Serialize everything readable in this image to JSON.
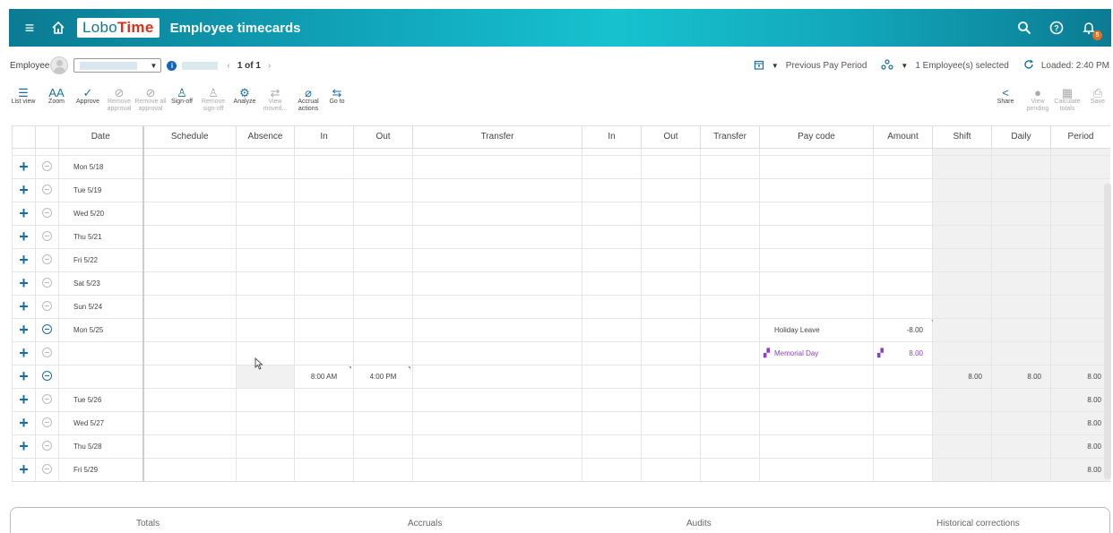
{
  "header": {
    "logo_lobo": "Lobo",
    "logo_time": "Time",
    "title": "Employee timecards",
    "notification_count": "5",
    "icons": [
      "menu-icon",
      "home-icon",
      "search-icon",
      "help-icon",
      "bell-icon"
    ]
  },
  "employee_bar": {
    "label": "Employee",
    "pager": "1 of 1",
    "period": "Previous Pay Period",
    "selected": "1 Employee(s) selected",
    "loaded": "Loaded: 2:40 PM"
  },
  "toolbar": {
    "left": [
      {
        "label": "List view",
        "icon": "list-icon",
        "glyph": "☰",
        "enabled": true
      },
      {
        "label": "Zoom",
        "icon": "zoom-icon",
        "glyph": "AA",
        "enabled": true
      },
      {
        "label": "Approve",
        "icon": "check-icon",
        "glyph": "✓",
        "enabled": true
      },
      {
        "label": "Remove approval",
        "icon": "remove-approval-icon",
        "glyph": "⊘",
        "enabled": false
      },
      {
        "label": "Remove all approval",
        "icon": "remove-all-approval-icon",
        "glyph": "⊘",
        "enabled": false
      },
      {
        "label": "Sign-off",
        "icon": "sign-off-icon",
        "glyph": "♙",
        "enabled": true
      },
      {
        "label": "Remove sign-off",
        "icon": "remove-sign-off-icon",
        "glyph": "♙",
        "enabled": false
      },
      {
        "label": "Analyze",
        "icon": "analyze-icon",
        "glyph": "⚙",
        "enabled": true
      },
      {
        "label": "View moved...",
        "icon": "view-moved-icon",
        "glyph": "⇄",
        "enabled": false
      },
      {
        "label": "Accrual actions",
        "icon": "accrual-icon",
        "glyph": "⌀",
        "enabled": true
      },
      {
        "label": "Go to",
        "icon": "goto-icon",
        "glyph": "⇆",
        "enabled": true
      }
    ],
    "right": [
      {
        "label": "Share",
        "icon": "share-icon",
        "glyph": "<",
        "enabled": true
      },
      {
        "label": "View pending",
        "icon": "view-pending-icon",
        "glyph": "●",
        "enabled": false
      },
      {
        "label": "Calculate totals",
        "icon": "calculate-icon",
        "glyph": "▦",
        "enabled": false
      },
      {
        "label": "Save",
        "icon": "save-icon",
        "glyph": "⎙",
        "enabled": false
      }
    ]
  },
  "table": {
    "columns": [
      "Date",
      "Schedule",
      "Absence",
      "In",
      "Out",
      "Transfer",
      "In",
      "Out",
      "Transfer",
      "Pay code",
      "Amount",
      "Shift",
      "Daily",
      "Period"
    ],
    "rows": [
      {
        "date": "Mon 5/18",
        "in1": "",
        "out1": "",
        "pay_code": "",
        "amount": "",
        "shift": "",
        "daily": "",
        "period": "",
        "active": false
      },
      {
        "date": "Tue 5/19",
        "in1": "",
        "out1": "",
        "pay_code": "",
        "amount": "",
        "shift": "",
        "daily": "",
        "period": "",
        "active": false
      },
      {
        "date": "Wed 5/20",
        "in1": "",
        "out1": "",
        "pay_code": "",
        "amount": "",
        "shift": "",
        "daily": "",
        "period": "",
        "active": false
      },
      {
        "date": "Thu 5/21",
        "in1": "",
        "out1": "",
        "pay_code": "",
        "amount": "",
        "shift": "",
        "daily": "",
        "period": "",
        "active": false
      },
      {
        "date": "Fri 5/22",
        "in1": "",
        "out1": "",
        "pay_code": "",
        "amount": "",
        "shift": "",
        "daily": "",
        "period": "",
        "active": false
      },
      {
        "date": "Sat 5/23",
        "in1": "",
        "out1": "",
        "pay_code": "",
        "amount": "",
        "shift": "",
        "daily": "",
        "period": "",
        "active": false
      },
      {
        "date": "Sun 5/24",
        "in1": "",
        "out1": "",
        "pay_code": "",
        "amount": "",
        "shift": "",
        "daily": "",
        "period": "",
        "active": false
      },
      {
        "date": "Mon 5/25",
        "in1": "",
        "out1": "",
        "pay_code": "Holiday Leave",
        "amount": "-8.00",
        "shift": "",
        "daily": "",
        "period": "",
        "active": true
      },
      {
        "date": "",
        "in1": "",
        "out1": "",
        "pay_code": "Memorial Day",
        "amount": "8.00",
        "shift": "",
        "daily": "",
        "period": "",
        "active": false,
        "purple": true
      },
      {
        "date": "",
        "in1": "8:00 AM",
        "out1": "4:00 PM",
        "pay_code": "",
        "amount": "",
        "shift": "8.00",
        "daily": "8.00",
        "period": "8.00",
        "active": true
      },
      {
        "date": "Tue 5/26",
        "in1": "",
        "out1": "",
        "pay_code": "",
        "amount": "",
        "shift": "",
        "daily": "",
        "period": "8.00",
        "active": false
      },
      {
        "date": "Wed 5/27",
        "in1": "",
        "out1": "",
        "pay_code": "",
        "amount": "",
        "shift": "",
        "daily": "",
        "period": "8.00",
        "active": false
      },
      {
        "date": "Thu 5/28",
        "in1": "",
        "out1": "",
        "pay_code": "",
        "amount": "",
        "shift": "",
        "daily": "",
        "period": "8.00",
        "active": false
      },
      {
        "date": "Fri 5/29",
        "in1": "",
        "out1": "",
        "pay_code": "",
        "amount": "",
        "shift": "",
        "daily": "",
        "period": "8.00",
        "active": false
      }
    ]
  },
  "bottom_tabs": [
    "Totals",
    "Accruals",
    "Audits",
    "Historical corrections"
  ],
  "colors": {
    "accent": "#1a6fa0",
    "header_start": "#0b7b93",
    "header_mid": "#17c2cf",
    "logo_red": "#d9311b",
    "purple": "#8a3fc4"
  }
}
